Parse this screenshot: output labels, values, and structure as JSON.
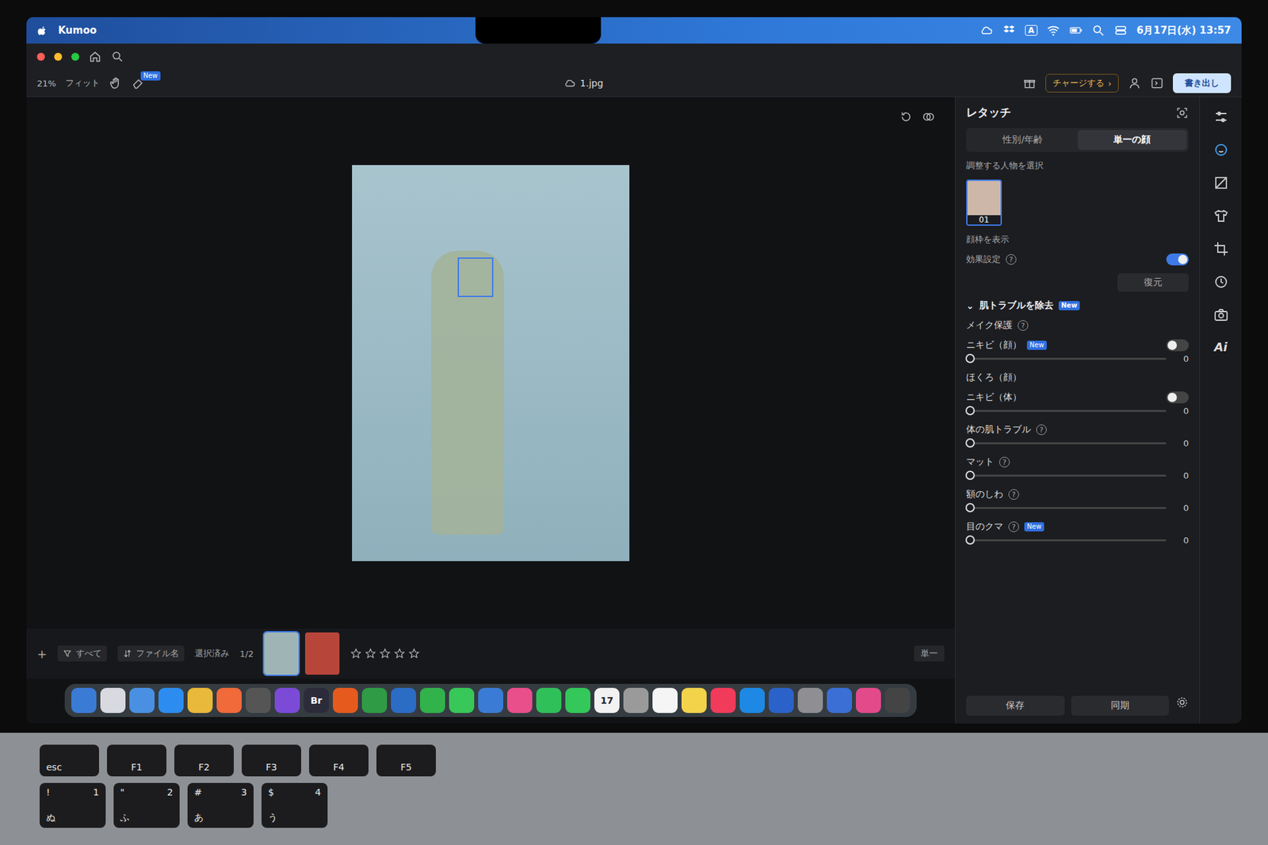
{
  "menubar": {
    "app": "Kumoo",
    "input": "A",
    "clock": "6月17日(水) 13:57"
  },
  "toolbar": {
    "zoom": "21%",
    "fit": "フィット",
    "new_badge": "New",
    "file": "1.jpg",
    "charge": "チャージする",
    "charge_arrow": "›",
    "export": "書き出し"
  },
  "retouch": {
    "title": "レタッチ",
    "tabs": [
      {
        "label": "性別/年齢",
        "selected": false
      },
      {
        "label": "単一の顔",
        "selected": true
      }
    ],
    "select_label": "調整する人物を選択",
    "faces": [
      {
        "label": "01",
        "selected": true
      }
    ],
    "show_frame": {
      "label": "顔枠を表示"
    },
    "effect": {
      "label": "効果設定",
      "help": "?",
      "on": true
    },
    "restore": "復元",
    "section": {
      "title": "肌トラブルを除去",
      "badge": "New",
      "arrow": "⌄"
    },
    "makeup": {
      "label": "メイク保護",
      "help": "?"
    },
    "rows": [
      {
        "kind": "toggle",
        "label": "ニキビ（顔）",
        "badge": "New",
        "help": "",
        "on": false,
        "level": 0,
        "reading": "0"
      },
      {
        "kind": "label",
        "label": "ほくろ（顔）",
        "badge": "",
        "help": "",
        "on": false,
        "level": 0,
        "reading": ""
      },
      {
        "kind": "toggle",
        "label": "ニキビ（体）",
        "badge": "",
        "help": "",
        "on": false,
        "level": 0,
        "reading": "0"
      },
      {
        "kind": "slider",
        "label": "体の肌トラブル",
        "badge": "",
        "help": "?",
        "on": false,
        "level": 0,
        "reading": "0"
      },
      {
        "kind": "slider",
        "label": "マット",
        "badge": "",
        "help": "?",
        "on": false,
        "level": 0,
        "reading": "0"
      },
      {
        "kind": "slider",
        "label": "額のしわ",
        "badge": "",
        "help": "?",
        "on": false,
        "level": 0,
        "reading": "0"
      },
      {
        "kind": "slider",
        "label": "目のクマ",
        "badge": "New",
        "help": "?",
        "on": false,
        "level": 0,
        "reading": "0"
      }
    ],
    "save": "保存",
    "sync": "同期"
  },
  "rail": {
    "ai": "Ai"
  },
  "filmstrip": {
    "add": "+",
    "filter": "すべて",
    "sort": "ファイル名",
    "selected_label": "選択済み",
    "count": "1/2",
    "thumbs": [
      {
        "selected": true,
        "color": "#9fb5b5"
      },
      {
        "selected": false,
        "color": "#b8453a"
      }
    ],
    "stars": 0,
    "star_total": 5,
    "view": "単一"
  },
  "dock": [
    {
      "label": "",
      "color": "#3a7bd5"
    },
    {
      "label": "",
      "color": "#d9d9e0"
    },
    {
      "label": "",
      "color": "#4a90e2"
    },
    {
      "label": "",
      "color": "#2d8cf0"
    },
    {
      "label": "",
      "color": "#e8b93a"
    },
    {
      "label": "",
      "color": "#f06a3a"
    },
    {
      "label": "",
      "color": "#555"
    },
    {
      "label": "",
      "color": "#7b4bd8"
    },
    {
      "label": "Br",
      "color": "#2b2b3a"
    },
    {
      "label": "",
      "color": "#e65a1e"
    },
    {
      "label": "",
      "color": "#2f9b45"
    },
    {
      "label": "",
      "color": "#2b6cc4"
    },
    {
      "label": "",
      "color": "#32b24b"
    },
    {
      "label": "",
      "color": "#38c759"
    },
    {
      "label": "",
      "color": "#3a7bd5"
    },
    {
      "label": "",
      "color": "#e94f8a"
    },
    {
      "label": "",
      "color": "#30c05a"
    },
    {
      "label": "",
      "color": "#34c759"
    },
    {
      "label": "17",
      "color": "#f2f2f2"
    },
    {
      "label": "",
      "color": "#9a9a9a"
    },
    {
      "label": "",
      "color": "#f5f5f5"
    },
    {
      "label": "",
      "color": "#f3d34a"
    },
    {
      "label": "",
      "color": "#f23a5a"
    },
    {
      "label": "",
      "color": "#1e88e5"
    },
    {
      "label": "",
      "color": "#2a62c9"
    },
    {
      "label": "",
      "color": "#8e8e93"
    },
    {
      "label": "",
      "color": "#3b6fd6"
    },
    {
      "label": "",
      "color": "#e24a8a"
    },
    {
      "label": "",
      "color": "#444"
    }
  ],
  "keyboard": {
    "fn": [
      "esc",
      "F1",
      "F2",
      "F3",
      "F4",
      "F5"
    ],
    "nums": [
      {
        "top": "!",
        "main": "1",
        "kana": "ぬ"
      },
      {
        "top": "\"",
        "main": "2",
        "kana": "ふ"
      },
      {
        "top": "#",
        "main": "3",
        "kana": "あ"
      },
      {
        "top": "$",
        "main": "4",
        "kana": "う"
      }
    ]
  }
}
